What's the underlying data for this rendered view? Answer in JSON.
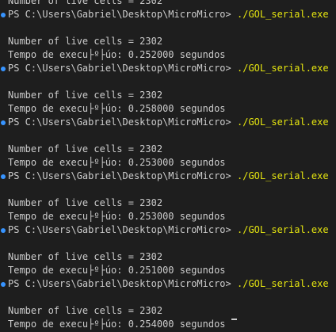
{
  "terminal": {
    "top_line": "Number of live cells = 2302",
    "prompt_path": "PS C:\\Users\\Gabriel\\Desktop\\MicroMicro>",
    "command": "./GOL_serial.exe",
    "runs": [
      {
        "cells": "Number of live cells = 2302",
        "time": "Tempo de execu├º├úo: 0.252000 segundos"
      },
      {
        "cells": "Number of live cells = 2302",
        "time": "Tempo de execu├º├úo: 0.258000 segundos"
      },
      {
        "cells": "Number of live cells = 2302",
        "time": "Tempo de execu├º├úo: 0.253000 segundos"
      },
      {
        "cells": "Number of live cells = 2302",
        "time": "Tempo de execu├º├úo: 0.253000 segundos"
      },
      {
        "cells": "Number of live cells = 2302",
        "time": "Tempo de execu├º├úo: 0.251000 segundos"
      },
      {
        "cells": "Number of live cells = 2302",
        "time": "Tempo de execu├º├úo: 0.254000 segundos"
      }
    ],
    "colors": {
      "background": "#1e1e1e",
      "text": "#cccccc",
      "command": "#e5e510",
      "prompt_marker": "#3794ff"
    }
  }
}
